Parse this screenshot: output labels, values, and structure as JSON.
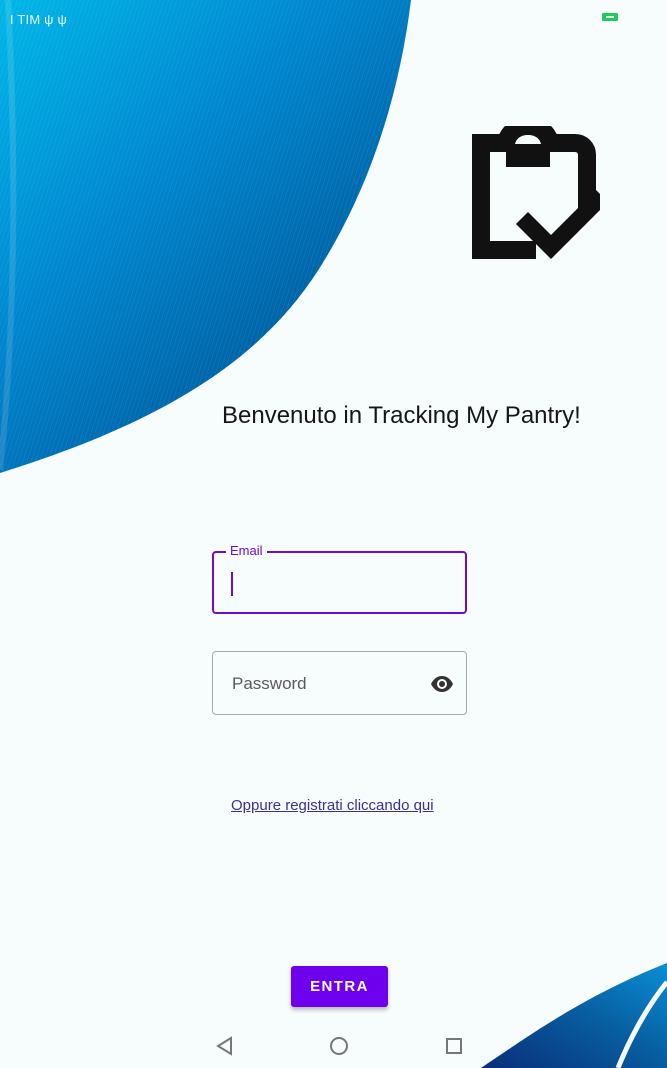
{
  "status_bar": {
    "carrier": "I TIM ψ ψ",
    "battery_color": "#21c860"
  },
  "logo": {
    "icon": "clipboard-check-icon"
  },
  "welcome": {
    "text": "Benvenuto in Tracking My Pantry!"
  },
  "form": {
    "email": {
      "label": "Email",
      "value": "",
      "placeholder": ""
    },
    "password": {
      "placeholder": "Password",
      "value": "",
      "toggle_icon": "eye-icon"
    },
    "register_link": "Oppure registrati cliccando qui",
    "submit_label": "ENTRA"
  },
  "nav_bar": {
    "back_icon": "triangle-back-icon",
    "home_icon": "circle-home-icon",
    "recents_icon": "square-recents-icon"
  },
  "colors": {
    "accent": "#6e0ad8",
    "button": "#6e00ed",
    "link": "#3d2f95",
    "background": "#f7fcfc",
    "decor_blue": "#006fb8"
  }
}
